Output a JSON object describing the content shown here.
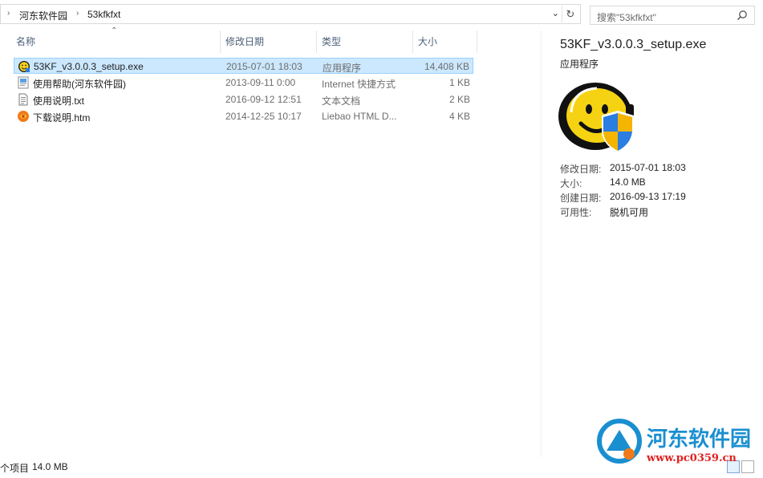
{
  "breadcrumb": {
    "items": [
      "河东软件园",
      "53kfkfxt"
    ]
  },
  "search": {
    "placeholder": "搜索\"53kfkfxt\""
  },
  "columns": {
    "name": "名称",
    "date": "修改日期",
    "type": "类型",
    "size": "大小"
  },
  "files": [
    {
      "name": "53KF_v3.0.0.3_setup.exe",
      "date": "2015-07-01 18:03",
      "type": "应用程序",
      "size": "14,408 KB",
      "icon": "smiley-app-icon",
      "selected": true
    },
    {
      "name": "使用帮助(河东软件园)",
      "date": "2013-09-11 0:00",
      "type": "Internet 快捷方式",
      "size": "1 KB",
      "icon": "internet-shortcut-icon",
      "selected": false
    },
    {
      "name": "使用说明.txt",
      "date": "2016-09-12 12:51",
      "type": "文本文档",
      "size": "2 KB",
      "icon": "text-document-icon",
      "selected": false
    },
    {
      "name": "下载说明.htm",
      "date": "2014-12-25 10:17",
      "type": "Liebao HTML D...",
      "size": "4 KB",
      "icon": "liebao-html-icon",
      "selected": false
    }
  ],
  "details": {
    "title": "53KF_v3.0.0.3_setup.exe",
    "type": "应用程序",
    "props": [
      {
        "label": "修改日期:",
        "value": "2015-07-01 18:03"
      },
      {
        "label": "大小:",
        "value": "14.0 MB"
      },
      {
        "label": "创建日期:",
        "value": "2016-09-13 17:19"
      },
      {
        "label": "可用性:",
        "value": "脱机可用"
      }
    ]
  },
  "status": {
    "count_text": "个项目",
    "selected_size": "14.0 MB"
  },
  "watermark": {
    "title": "河东软件园",
    "url": "www.pc0359.cn"
  },
  "colors": {
    "selection_bg": "#cce8ff",
    "selection_border": "#99d1ff",
    "header_text": "#4c607a",
    "watermark_blue": "#1a8fd0",
    "watermark_red": "#e02020"
  }
}
